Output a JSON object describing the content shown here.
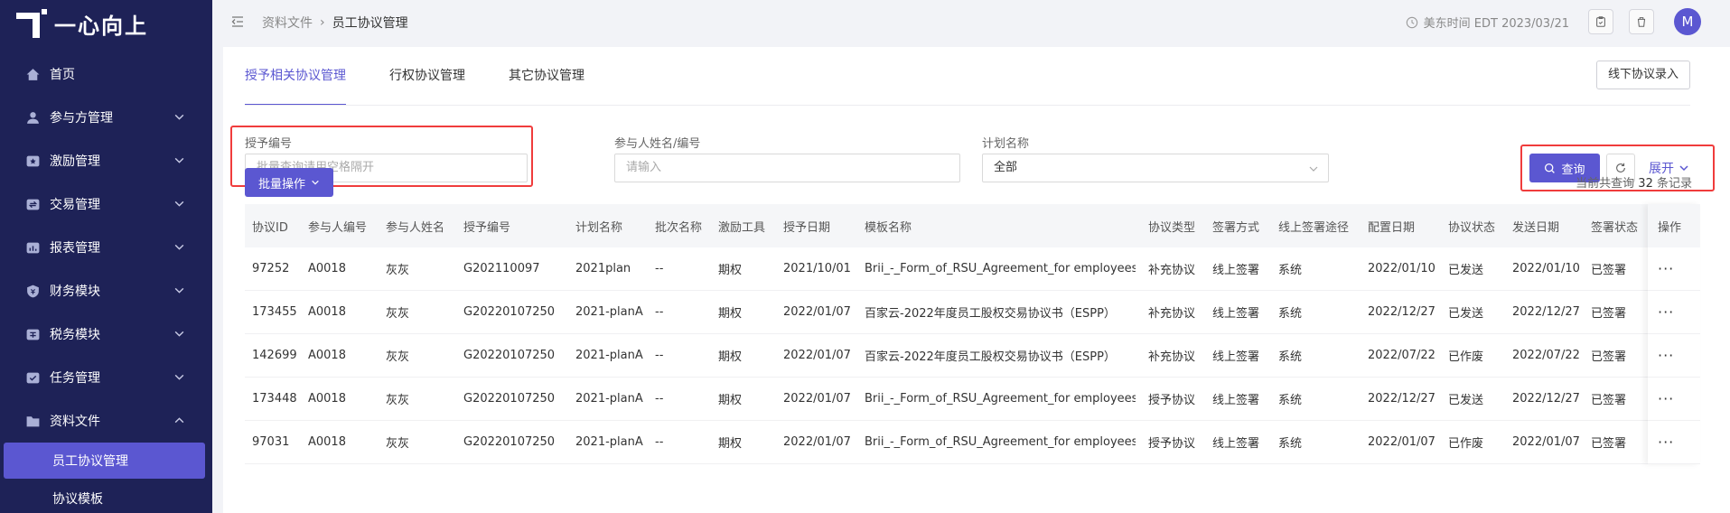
{
  "brand": {
    "name": "一心向上"
  },
  "sidebar": {
    "items": [
      {
        "label": "首页",
        "icon": "home-icon"
      },
      {
        "label": "参与方管理",
        "icon": "users-icon"
      },
      {
        "label": "激励管理",
        "icon": "star-icon"
      },
      {
        "label": "交易管理",
        "icon": "transaction-icon"
      },
      {
        "label": "报表管理",
        "icon": "report-icon"
      },
      {
        "label": "财务模块",
        "icon": "finance-icon"
      },
      {
        "label": "税务模块",
        "icon": "tax-icon"
      },
      {
        "label": "任务管理",
        "icon": "task-icon"
      },
      {
        "label": "资料文件",
        "icon": "folder-icon"
      }
    ],
    "sub_items": [
      {
        "label": "员工协议管理",
        "active": true
      },
      {
        "label": "协议模板",
        "active": false
      }
    ]
  },
  "header": {
    "breadcrumb": [
      "资料文件",
      "员工协议管理"
    ],
    "time": "美东时间 EDT 2023/03/21",
    "avatar": "M"
  },
  "tabs": [
    "授予相关协议管理",
    "行权协议管理",
    "其它协议管理"
  ],
  "offline_button": "线下协议录入",
  "filters": {
    "grant_no": {
      "label": "授予编号",
      "placeholder": "批量查询请用空格隔开"
    },
    "participant": {
      "label": "参与人姓名/编号",
      "placeholder": "请输入"
    },
    "plan": {
      "label": "计划名称",
      "value": "全部"
    }
  },
  "actions": {
    "query": "查询",
    "expand": "展开",
    "batch": "批量操作"
  },
  "result_count": {
    "prefix": "当前共查询",
    "count": "32",
    "suffix": "条记录"
  },
  "table": {
    "columns": [
      "协议ID",
      "参与人编号",
      "参与人姓名",
      "授予编号",
      "计划名称",
      "批次名称",
      "激励工具",
      "授予日期",
      "模板名称",
      "协议类型",
      "签署方式",
      "线上签署途径",
      "配置日期",
      "协议状态",
      "发送日期",
      "签署状态",
      "操作"
    ],
    "rows": [
      [
        "97252",
        "A0018",
        "灰灰",
        "G202110097",
        "2021plan",
        "--",
        "期权",
        "2021/10/01",
        "Brii_-_Form_of_RSU_Agreement_for employees...",
        "补充协议",
        "线上签署",
        "系统",
        "2022/01/10",
        "已发送",
        "2022/01/10",
        "已签署",
        "···"
      ],
      [
        "173455",
        "A0018",
        "灰灰",
        "G20220107250",
        "2021-planA",
        "--",
        "期权",
        "2022/01/07",
        "百家云-2022年度员工股权交易协议书（ESPP）",
        "补充协议",
        "线上签署",
        "系统",
        "2022/12/27",
        "已发送",
        "2022/12/27",
        "已签署",
        "···"
      ],
      [
        "142699",
        "A0018",
        "灰灰",
        "G20220107250",
        "2021-planA",
        "--",
        "期权",
        "2022/01/07",
        "百家云-2022年度员工股权交易协议书（ESPP）",
        "补充协议",
        "线上签署",
        "系统",
        "2022/07/22",
        "已作废",
        "2022/07/22",
        "已签署",
        "···"
      ],
      [
        "173448",
        "A0018",
        "灰灰",
        "G20220107250",
        "2021-planA",
        "--",
        "期权",
        "2022/01/07",
        "Brii_-_Form_of_RSU_Agreement_for employees...",
        "授予协议",
        "线上签署",
        "系统",
        "2022/12/27",
        "已发送",
        "2022/12/27",
        "已签署",
        "···"
      ],
      [
        "97031",
        "A0018",
        "灰灰",
        "G20220107250",
        "2021-planA",
        "--",
        "期权",
        "2022/01/07",
        "Brii_-_Form_of_RSU_Agreement_for employees...",
        "授予协议",
        "线上签署",
        "系统",
        "2022/01/07",
        "已作废",
        "2022/01/07",
        "已签署",
        "···"
      ]
    ]
  },
  "colors": {
    "sidebar": "#1e2257",
    "accent": "#5b57d1",
    "highlight": "#f03c3c"
  }
}
